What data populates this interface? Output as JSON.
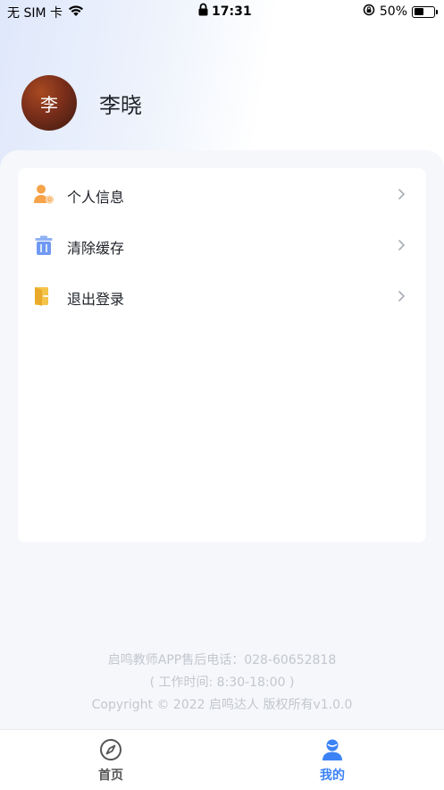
{
  "status_bar": {
    "carrier": "无 SIM 卡",
    "time": "17:31",
    "battery_percent": "50%",
    "battery_level": 0.5
  },
  "profile": {
    "avatar_text": "李",
    "name": "李晓"
  },
  "menu": {
    "items": [
      {
        "label": "个人信息",
        "icon": "user-settings-icon"
      },
      {
        "label": "清除缓存",
        "icon": "trash-icon"
      },
      {
        "label": "退出登录",
        "icon": "logout-icon"
      }
    ]
  },
  "footer": {
    "hotline": "启鸣教师APP售后电话：028-60652818",
    "hours": "( 工作时间: 8:30-18:00 )",
    "copyright": "Copyright © 2022 启鸣达人 版权所有v1.0.0"
  },
  "tabs": [
    {
      "label": "首页",
      "icon": "compass-icon",
      "active": false
    },
    {
      "label": "我的",
      "icon": "user-icon",
      "active": true
    }
  ],
  "colors": {
    "accent": "#3b82f6",
    "inactive_tab": "#555555",
    "footer_text": "#c3c7ce"
  }
}
